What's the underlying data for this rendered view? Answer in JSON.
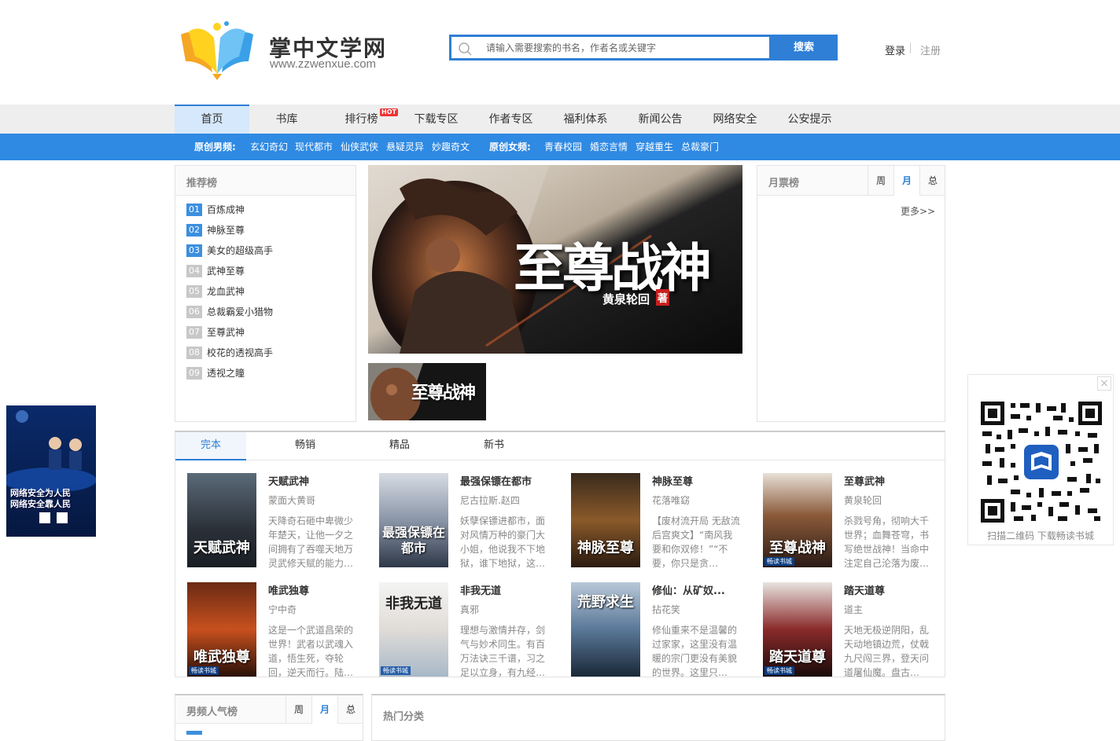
{
  "header": {
    "site_name": "掌中文学网",
    "site_url": "www.zzwenxue.com",
    "search_placeholder": "请输入需要搜索的书名，作者名或关键字",
    "search_button": "搜索",
    "login": "登录",
    "register": "注册"
  },
  "nav": {
    "items": [
      "首页",
      "书库",
      "排行榜",
      "下载专区",
      "作者专区",
      "福利体系",
      "新闻公告",
      "网络安全",
      "公安提示"
    ],
    "hot_badge": "HOT",
    "active_index": 0
  },
  "subnav": {
    "male_label": "原创男频:",
    "male_items": [
      "玄幻奇幻",
      "现代都市",
      "仙侠武侠",
      "悬疑灵异",
      "妙趣奇文"
    ],
    "female_label": "原创女频:",
    "female_items": [
      "青春校园",
      "婚恋言情",
      "穿越重生",
      "总裁豪门"
    ]
  },
  "recommend": {
    "title": "推荐榜",
    "items": [
      {
        "num": "01",
        "label": "百炼成神"
      },
      {
        "num": "02",
        "label": "神脉至尊"
      },
      {
        "num": "03",
        "label": "美女的超级高手"
      },
      {
        "num": "04",
        "label": "武神至尊"
      },
      {
        "num": "05",
        "label": "龙血武神"
      },
      {
        "num": "06",
        "label": "总裁霸爱小猎物"
      },
      {
        "num": "07",
        "label": "至尊武神"
      },
      {
        "num": "08",
        "label": "校花的透视高手"
      },
      {
        "num": "09",
        "label": "透视之瞳"
      }
    ]
  },
  "banner": {
    "title": "至尊战神",
    "author": "黄泉轮回",
    "seal": "著"
  },
  "monthly": {
    "title": "月票榜",
    "tabs": [
      "周",
      "月",
      "总"
    ],
    "active_tab": 1,
    "more": "更多>>"
  },
  "books": {
    "tabs": [
      "完本",
      "畅销",
      "精品",
      "新书"
    ],
    "active_tab": 0,
    "items": [
      {
        "title": "天赋武神",
        "author": "蒙面大黄哥",
        "desc": "天降奇石砸中卑微少年楚天，让他一夕之间拥有了吞噬天地万灵武修天赋的能力…",
        "cover_text": "天赋武神",
        "badge": ""
      },
      {
        "title": "最强保镖在都市",
        "author": "尼古拉斯.赵四",
        "desc": "妖孽保镖进都市，面对风情万种的豪门大小姐，他说我不下地狱，谁下地狱，这…",
        "cover_text": "最强保镖在都市",
        "badge": ""
      },
      {
        "title": "神脉至尊",
        "author": "花落唯窈",
        "desc": "【废材流开局 无敌流 后宫爽文】“南风我要和你双修！”“不要，你只是贪…",
        "cover_text": "神脉至尊",
        "badge": ""
      },
      {
        "title": "至尊武神",
        "author": "黄泉轮回",
        "desc": "杀戮号角，彻响大千世界；血舞苍穹，书写绝世战神！当命中注定自己沦落为废…",
        "cover_text": "至尊战神",
        "badge": "畅读书城"
      },
      {
        "title": "唯武独尊",
        "author": "宁中奇",
        "desc": "这是一个武道昌荣的世界！武者以武魂入道，悟生死，夺轮回，逆天而行。陆…",
        "cover_text": "唯武独尊",
        "badge": "畅读书城"
      },
      {
        "title": "非我无道",
        "author": "真邪",
        "desc": "理想与激情并存，剑气与妙术同生。有百万法诀三千谱，习之足以立身，有九经…",
        "cover_text": "非我无道",
        "badge": "畅读书城"
      },
      {
        "title": "修仙：从矿奴...",
        "author": "拈花笑",
        "desc": "修仙重来不是温馨的过家家，这里没有温暖的宗门更没有美貌的世界。这里只…",
        "cover_text": "荒野求生",
        "badge": ""
      },
      {
        "title": "踏天道尊",
        "author": "道主",
        "desc": "天地无极逆阴阳，乱天动地镇边荒，仗戟九尺闯三界，登天问道屠仙魔。盘古…",
        "cover_text": "踏天道尊",
        "badge": "畅读书城"
      }
    ]
  },
  "bottom": {
    "male_pop_title": "男频人气榜",
    "male_pop_tabs": [
      "周",
      "月",
      "总"
    ],
    "male_pop_active": 1,
    "hot_cat_title": "热门分类"
  },
  "qr": {
    "caption": "扫描二维码 下载畅读书城",
    "close": "×"
  },
  "side_ad": {
    "line1": "网络安全为人民",
    "line2": "网络安全靠人民"
  },
  "colors": {
    "accent": "#2f7fd6",
    "subnav": "#2f8ae3",
    "nav_bg": "#eeeeee",
    "active_nav": "#d6e8fb"
  }
}
